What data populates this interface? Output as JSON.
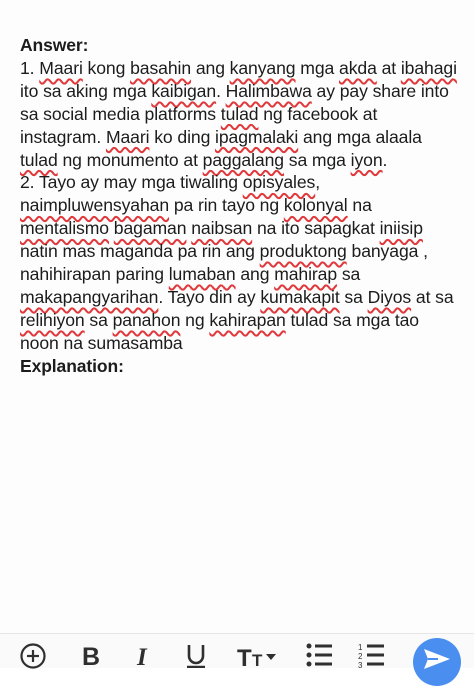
{
  "answer_heading": "Answer:",
  "explanation_heading": "Explanation:",
  "paragraphs": [
    [
      {
        "t": "1. "
      },
      {
        "t": "Maari",
        "err": true
      },
      {
        "t": " kong "
      },
      {
        "t": "basahin",
        "err": true
      },
      {
        "t": " ang "
      },
      {
        "t": "kanyang",
        "err": true
      },
      {
        "t": " mga "
      },
      {
        "t": "akda",
        "err": true
      },
      {
        "t": " at "
      },
      {
        "t": "ibahagi",
        "err": true
      },
      {
        "t": " ito sa aking mga "
      },
      {
        "t": "kaibigan",
        "err": true
      },
      {
        "t": ". "
      },
      {
        "t": "Halimbawa",
        "err": true
      },
      {
        "t": " ay pay share into sa social media platforms "
      },
      {
        "t": "tulad",
        "err": true
      },
      {
        "t": " ng facebook at instagram. "
      },
      {
        "t": "Maari",
        "err": true
      },
      {
        "t": " ko ding "
      },
      {
        "t": "ipagmalaki",
        "err": true
      },
      {
        "t": " ang mga alaala "
      },
      {
        "t": "tulad",
        "err": true
      },
      {
        "t": " ng monumento at "
      },
      {
        "t": "paggalang",
        "err": true
      },
      {
        "t": " sa mga "
      },
      {
        "t": "iyon",
        "err": true
      },
      {
        "t": "."
      }
    ],
    [
      {
        "t": "2. Tayo ay may mga tiwaling "
      },
      {
        "t": "opisyales",
        "err": true
      },
      {
        "t": ", "
      },
      {
        "t": "naimpluwensyahan",
        "err": true
      },
      {
        "t": " pa rin tayo ng "
      },
      {
        "t": "kolonyal",
        "err": true
      },
      {
        "t": " na "
      },
      {
        "t": "mentalismo",
        "err": true
      },
      {
        "t": " "
      },
      {
        "t": "bagaman",
        "err": true
      },
      {
        "t": " "
      },
      {
        "t": "naibsan",
        "err": true
      },
      {
        "t": " na ito sapagkat "
      },
      {
        "t": "iniisip",
        "err": true
      },
      {
        "t": " natin mas maganda pa rin ang "
      },
      {
        "t": "produktong",
        "err": true
      },
      {
        "t": " banyaga , nahihirapan paring "
      },
      {
        "t": "lumaban",
        "err": true
      },
      {
        "t": " ang "
      },
      {
        "t": "mahirap",
        "err": true
      },
      {
        "t": " sa "
      },
      {
        "t": "makapangyarihan",
        "err": true
      },
      {
        "t": ". Tayo din ay "
      },
      {
        "t": "kumakapit",
        "err": true
      },
      {
        "t": " sa "
      },
      {
        "t": "Diyos",
        "err": true
      },
      {
        "t": " at sa "
      },
      {
        "t": "relihiyon",
        "err": true
      },
      {
        "t": " sa "
      },
      {
        "t": "panahon",
        "err": true
      },
      {
        "t": " ng "
      },
      {
        "t": "kahirapan",
        "err": true
      },
      {
        "t": " tulad sa mga tao noon na sumasamba"
      }
    ]
  ],
  "toolbar": {
    "items": [
      {
        "name": "add-icon"
      },
      {
        "name": "bold-icon"
      },
      {
        "name": "italic-icon"
      },
      {
        "name": "underline-icon"
      },
      {
        "name": "text-size-icon"
      },
      {
        "name": "bullet-list-icon"
      },
      {
        "name": "numbered-list-icon"
      }
    ],
    "send": {
      "name": "send-icon",
      "color": "#4a8ff0"
    }
  },
  "colors": {
    "spellcheck_underline": "#e0383b",
    "text": "#1c1c1c"
  }
}
